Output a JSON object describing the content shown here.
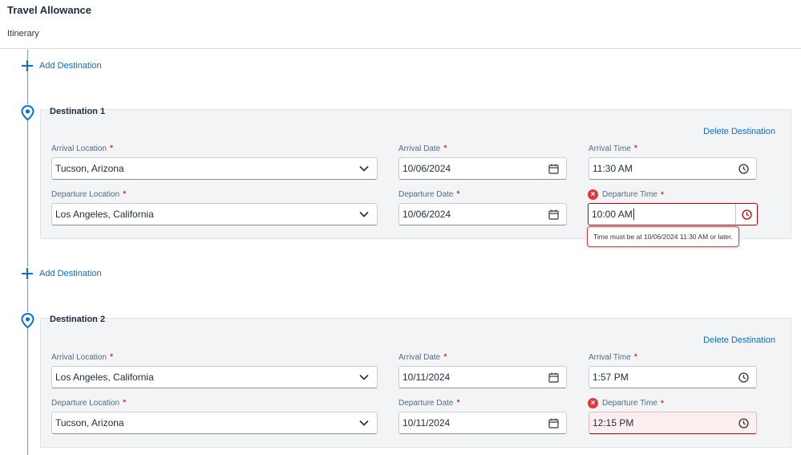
{
  "header": {
    "title": "Travel Allowance",
    "breadcrumb": "Itinerary"
  },
  "add_destination_label": "Add Destination",
  "delete_destination_label": "Delete Destination",
  "labels": {
    "arrival_location": "Arrival Location",
    "arrival_date": "Arrival Date",
    "arrival_time": "Arrival Time",
    "departure_location": "Departure Location",
    "departure_date": "Departure Date",
    "departure_time": "Departure Time",
    "required_marker": "*"
  },
  "destinations": [
    {
      "title": "Destination 1",
      "arrival_location": "Tucson, Arizona",
      "arrival_date": "10/06/2024",
      "arrival_time": "11:30 AM",
      "departure_location": "Los Angeles, California",
      "departure_date": "10/06/2024",
      "departure_time": "10:00 AM",
      "departure_time_state": "error-focused",
      "error_message": "Time must be at 10/06/2024 11:30 AM or later."
    },
    {
      "title": "Destination 2",
      "arrival_location": "Los Angeles, California",
      "arrival_date": "10/11/2024",
      "arrival_time": "1:57 PM",
      "departure_location": "Tucson, Arizona",
      "departure_date": "10/11/2024",
      "departure_time": "12:15 PM",
      "departure_time_state": "error"
    }
  ],
  "icons": {
    "add": "plus-icon",
    "destination": "map-pin-icon",
    "dropdown": "chevron-down-icon",
    "date": "calendar-icon",
    "time": "clock-icon",
    "error": "error-icon"
  },
  "colors": {
    "accent": "#0a6ed1",
    "error": "#bb0000",
    "panel_bg": "#f2f4f6"
  }
}
